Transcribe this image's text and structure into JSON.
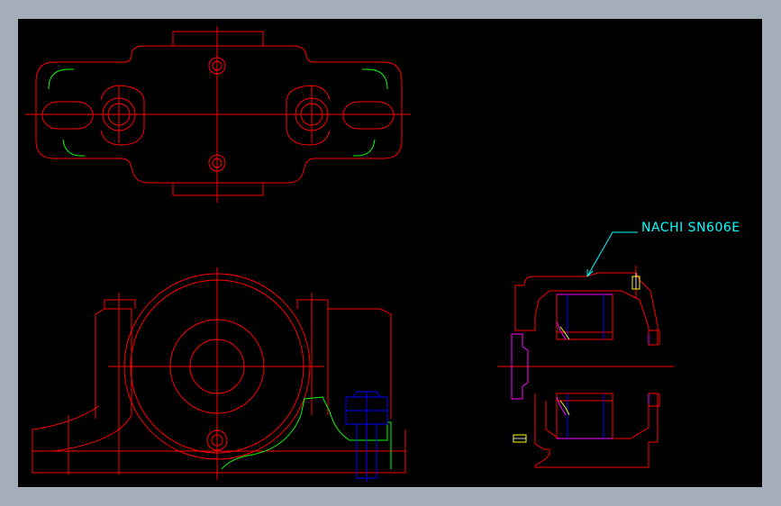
{
  "drawing": {
    "label": "NACHI SN606E",
    "colors": {
      "frame": "#a4aeb9",
      "background": "#000000",
      "outline": "#ff0000",
      "hatch": "#00ff00",
      "bolt": "#0000ff",
      "seal": "#ff00ff",
      "leader": "#00ffff",
      "detail": "#ffff00",
      "highlight": "#ffffff"
    }
  }
}
